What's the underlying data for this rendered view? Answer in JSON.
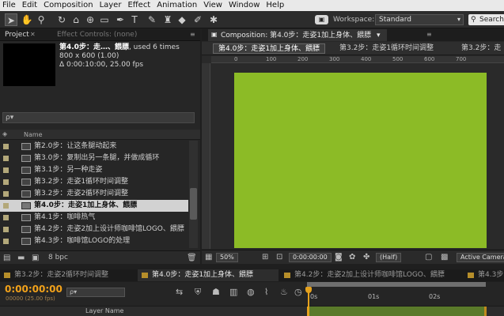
{
  "menu": [
    "File",
    "Edit",
    "Composition",
    "Layer",
    "Effect",
    "Animation",
    "View",
    "Window",
    "Help"
  ],
  "toolbar": {
    "workspace_label": "Workspace:",
    "workspace_value": "Standard",
    "search_label": "Search"
  },
  "project_panel": {
    "tab_project": "Project",
    "tab_effect_controls": "Effect Controls: (none)",
    "comp_name": "第4.0步：走…、餵膘",
    "comp_used": ", used 6 times",
    "comp_size": "800 x 600 (1.00)",
    "comp_duration": "Δ 0:00:10:00, 25.00 fps",
    "search_placeholder": "ρ▾",
    "column_name": "Name",
    "items": [
      "第2.0步：让这条腿动起来",
      "第3.0步：复制出另一条腿，并做成循环",
      "第3.1步：另一种走姿",
      "第3.2步：走姿1循环时间调整",
      "第3.2步：走姿2循环时间调整",
      "第4.0步：走姿1加上身体、餵膘",
      "第4.1步：咖啡热气",
      "第4.2步：走姿2加上设计师咖啡馆LOGO、餵膘",
      "第4.3步：咖啡馆LOGO的处理"
    ],
    "selected_index": 5,
    "bpc": "8 bpc"
  },
  "composition_panel": {
    "tab_label": "Composition: 第4.0步：走姿1加上身体、餵膘",
    "subtabs": [
      "第4.0步：走姿1加上身体、餵膘",
      "第3.2步：走姿1循环时间调整",
      "第3.2步：走"
    ],
    "ruler_labels": [
      "0",
      "100",
      "200",
      "300",
      "400",
      "500",
      "600",
      "700"
    ],
    "frame_color": "#8cbb26",
    "zoom": "50%",
    "timecode": "0:00:00:00",
    "resolution": "(Half)",
    "camera": "Active Camera"
  },
  "timeline": {
    "tabs": [
      "第3.2步：走姿2循环时间调整",
      "第4.0步：走姿1加上身体、餵膘",
      "第4.2步：走姿2加上设计师咖啡馆LOGO、餵膘",
      "第4.3步"
    ],
    "active_tab": 1,
    "timecode": "0:00:00:00",
    "fps": "00000 (25.00 fps)",
    "search_placeholder": "ρ▾",
    "ticks": [
      "0s",
      "01s",
      "02s"
    ],
    "layer_name_header": "Layer Name"
  },
  "accent_color": "#e6a21d"
}
